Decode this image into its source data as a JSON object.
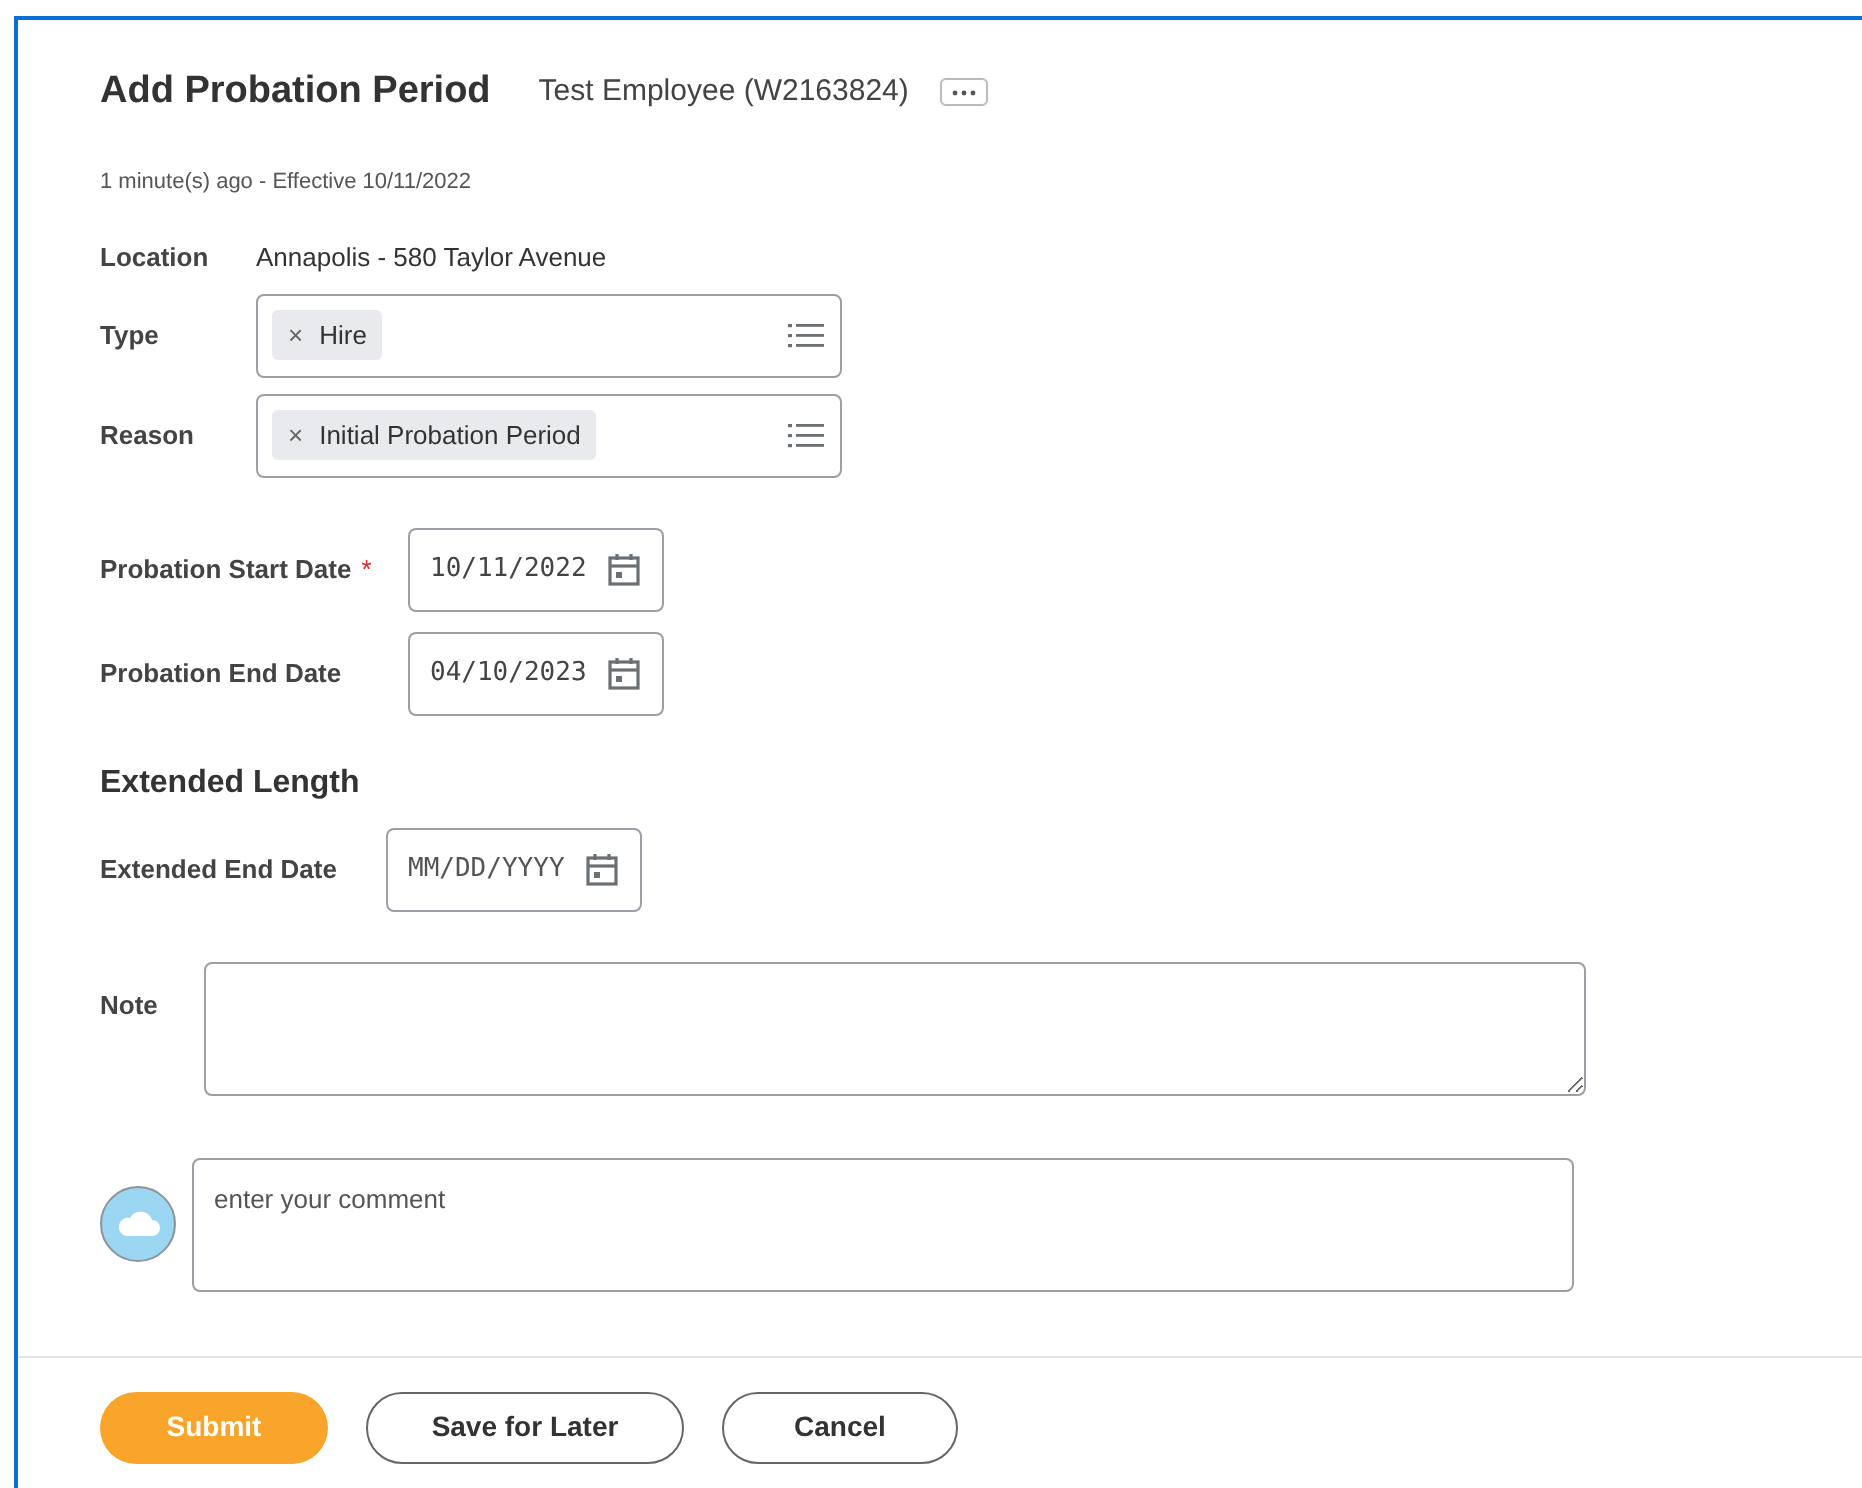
{
  "header": {
    "title": "Add Probation Period",
    "subject": "Test Employee (W2163824)",
    "meta": "1 minute(s) ago -  Effective 10/11/2022"
  },
  "fields": [
    {
      "kind": "text",
      "label": "Location",
      "value": "Annapolis - 580 Taylor Avenue"
    },
    {
      "kind": "multiselect",
      "label": "Type",
      "chips": [
        {
          "remove": "×",
          "text": "Hire"
        }
      ]
    },
    {
      "kind": "multiselect",
      "label": "Reason",
      "chips": [
        {
          "remove": "×",
          "text": "Initial Probation Period"
        }
      ]
    },
    {
      "kind": "date",
      "label": "Probation Start Date",
      "required": true,
      "required_marker": "*",
      "value": "10/11/2022"
    },
    {
      "kind": "date",
      "label": "Probation End Date",
      "required": false,
      "value": "04/10/2023"
    }
  ],
  "extended": {
    "heading": "Extended Length",
    "fields": [
      {
        "kind": "date",
        "label": "Extended End Date",
        "required": false,
        "placeholder": "MM/DD/YYYY"
      }
    ]
  },
  "note": {
    "label": "Note"
  },
  "comment": {
    "placeholder": "enter your comment"
  },
  "buttons": [
    {
      "kind": "primary",
      "label": "Submit"
    },
    {
      "kind": "outline",
      "label": "Save for Later"
    },
    {
      "kind": "outline",
      "label": "Cancel"
    }
  ]
}
